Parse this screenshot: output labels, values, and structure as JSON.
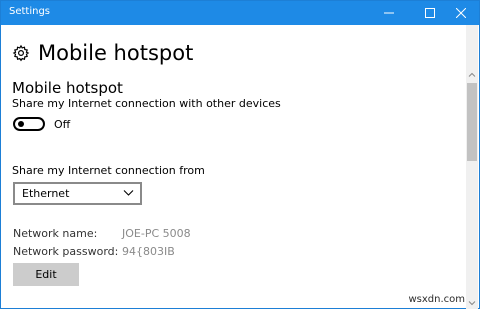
{
  "window": {
    "title": "Settings",
    "controls": [
      "minimize",
      "maximize",
      "close"
    ]
  },
  "page": {
    "title": "Mobile hotspot",
    "icon": "gear-icon"
  },
  "hotspot": {
    "section_title": "Mobile hotspot",
    "description": "Share my Internet connection with other devices",
    "toggle_state": "Off"
  },
  "connection": {
    "label": "Share my Internet connection from",
    "selected": "Ethernet"
  },
  "network": {
    "name_label": "Network name:",
    "name_value": "JOE-PC 5008",
    "password_label": "Network password:",
    "password_value": "94{803IB"
  },
  "buttons": {
    "edit_label": "Edit"
  },
  "watermark": "wsxdn.com",
  "colors": {
    "titlebar": "#1e8ae6",
    "button_bg": "#cccccc",
    "muted_text": "#8a8a8a"
  }
}
